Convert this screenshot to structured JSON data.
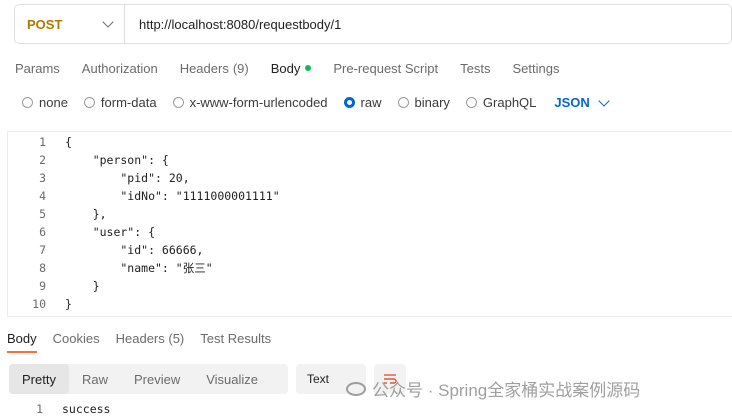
{
  "request": {
    "method": "POST",
    "url": "http://localhost:8080/requestbody/1"
  },
  "tabs": [
    {
      "label": "Params"
    },
    {
      "label": "Authorization"
    },
    {
      "label": "Headers",
      "count": "(9)"
    },
    {
      "label": "Body",
      "active": true
    },
    {
      "label": "Pre-request Script"
    },
    {
      "label": "Tests"
    },
    {
      "label": "Settings"
    }
  ],
  "body_types": {
    "options": [
      "none",
      "form-data",
      "x-www-form-urlencoded",
      "raw",
      "binary",
      "GraphQL"
    ],
    "selected": "raw",
    "format": "JSON"
  },
  "editor": {
    "lines": [
      {
        "n": "1",
        "text": "{"
      },
      {
        "n": "2",
        "text": "    \"person\": {"
      },
      {
        "n": "3",
        "text": "        \"pid\": 20,"
      },
      {
        "n": "4",
        "text": "        \"idNo\": \"1111000001111\""
      },
      {
        "n": "5",
        "text": "    },"
      },
      {
        "n": "6",
        "text": "    \"user\": {"
      },
      {
        "n": "7",
        "text": "        \"id\": 66666,"
      },
      {
        "n": "8",
        "text": "        \"name\": \"张三\""
      },
      {
        "n": "9",
        "text": "    }"
      },
      {
        "n": "10",
        "text": "}"
      }
    ]
  },
  "response": {
    "tabs": [
      {
        "label": "Body",
        "active": true
      },
      {
        "label": "Cookies"
      },
      {
        "label": "Headers",
        "count": "(5)"
      },
      {
        "label": "Test Results"
      }
    ],
    "views": [
      "Pretty",
      "Raw",
      "Preview",
      "Visualize"
    ],
    "active_view": "Pretty",
    "format": "Text",
    "line": {
      "n": "1",
      "text": "success"
    }
  },
  "watermark": {
    "text": "公众号 · Spring全家桶实战案例源码"
  },
  "colors": {
    "method": "#ad7a03",
    "accent": "#0265d2",
    "active_dot": "#0cbb52",
    "tab_underline": "#ff6c37"
  }
}
